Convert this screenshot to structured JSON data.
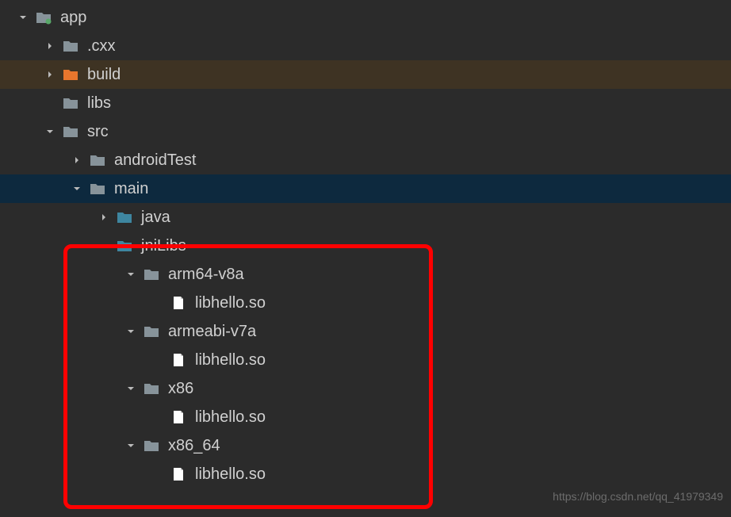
{
  "tree": {
    "app": {
      "label": "app"
    },
    "cxx": {
      "label": ".cxx"
    },
    "build": {
      "label": "build"
    },
    "libs": {
      "label": "libs"
    },
    "src": {
      "label": "src"
    },
    "androidTest": {
      "label": "androidTest"
    },
    "main": {
      "label": "main"
    },
    "java": {
      "label": "java"
    },
    "jniLibs": {
      "label": "jniLibs"
    },
    "arm64v8a": {
      "label": "arm64-v8a"
    },
    "armeabiv7a": {
      "label": "armeabi-v7a"
    },
    "x86": {
      "label": "x86"
    },
    "x86_64": {
      "label": "x86_64"
    },
    "libhello1": {
      "label": "libhello.so"
    },
    "libhello2": {
      "label": "libhello.so"
    },
    "libhello3": {
      "label": "libhello.so"
    },
    "libhello4": {
      "label": "libhello.so"
    }
  },
  "watermark": "https://blog.csdn.net/qq_41979349",
  "colors": {
    "folder_gray": "#87939a",
    "folder_orange": "#e8762d",
    "folder_teal": "#3e86a0",
    "file_white": "#ffffff",
    "dot_green": "#59a869"
  }
}
